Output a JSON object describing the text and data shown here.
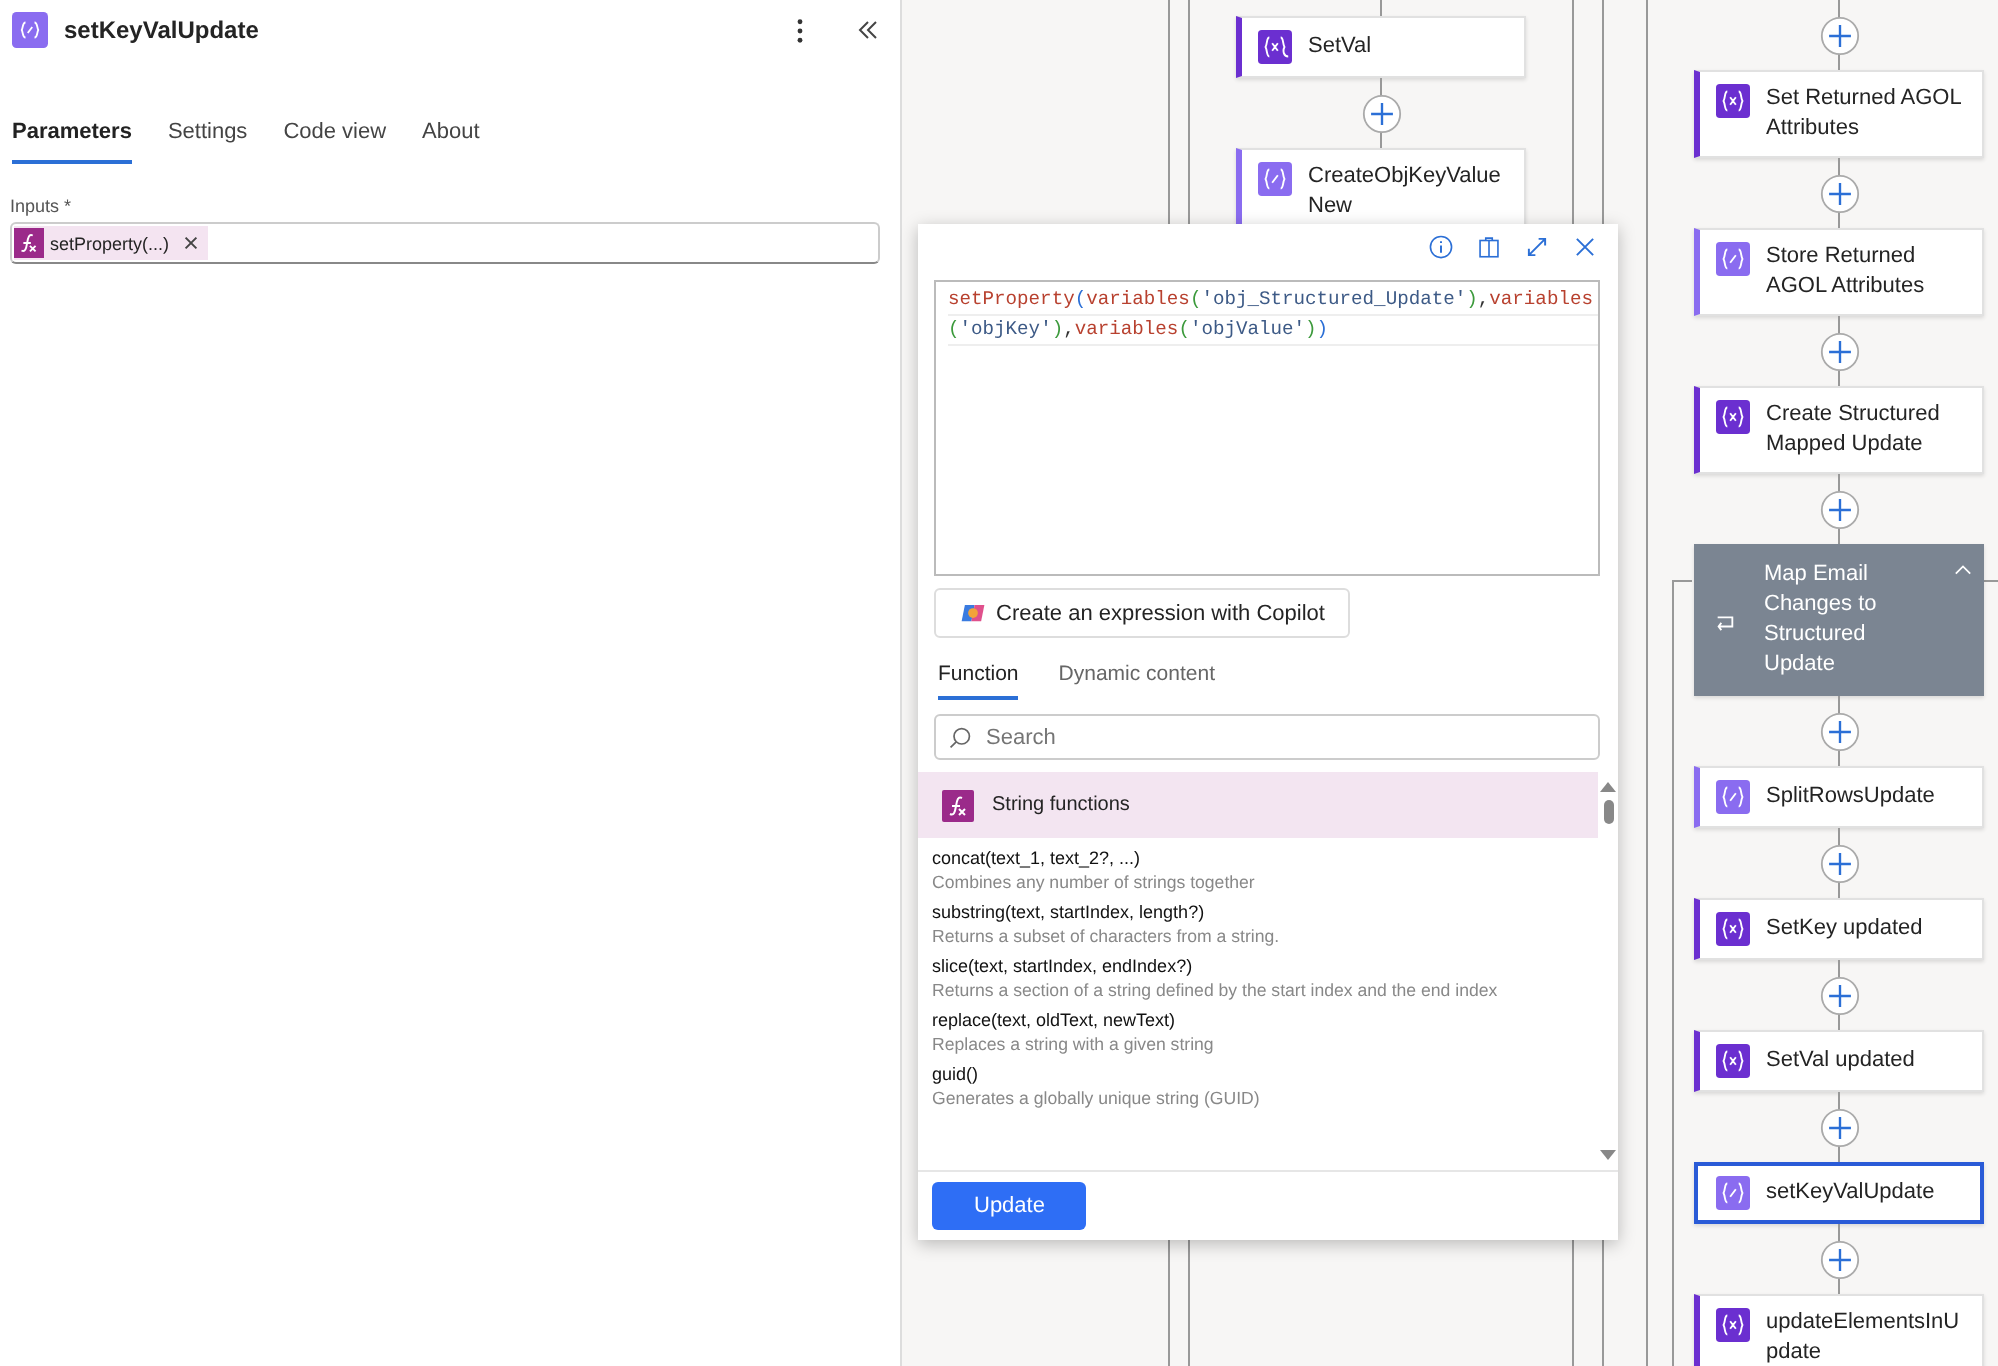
{
  "panel": {
    "title": "setKeyValUpdate",
    "tabs": [
      {
        "label": "Parameters",
        "selected": true
      },
      {
        "label": "Settings",
        "selected": false
      },
      {
        "label": "Code view",
        "selected": false
      },
      {
        "label": "About",
        "selected": false
      }
    ],
    "inputs_label": "Inputs *",
    "input_token": "setProperty(...)"
  },
  "expression_editor": {
    "code_lines": [
      [
        {
          "text": "setProperty",
          "kind": "fn"
        },
        {
          "text": "(",
          "kind": "paren1"
        },
        {
          "text": "variables",
          "kind": "fn"
        },
        {
          "text": "(",
          "kind": "paren2"
        },
        {
          "text": "'obj_Structured_Update'",
          "kind": "str"
        },
        {
          "text": ")",
          "kind": "paren2"
        },
        {
          "text": ",",
          "kind": "comma"
        },
        {
          "text": "variables",
          "kind": "fn"
        }
      ],
      [
        {
          "text": "(",
          "kind": "paren2"
        },
        {
          "text": "'objKey'",
          "kind": "str"
        },
        {
          "text": ")",
          "kind": "paren2"
        },
        {
          "text": ",",
          "kind": "comma"
        },
        {
          "text": "variables",
          "kind": "fn"
        },
        {
          "text": "(",
          "kind": "paren2"
        },
        {
          "text": "'objValue'",
          "kind": "str"
        },
        {
          "text": ")",
          "kind": "paren2"
        },
        {
          "text": ")",
          "kind": "paren1"
        }
      ]
    ],
    "copilot_button": "Create an expression with Copilot",
    "tabs": [
      {
        "label": "Function",
        "selected": true
      },
      {
        "label": "Dynamic content",
        "selected": false
      }
    ],
    "search": {
      "placeholder": "Search"
    },
    "category": "String functions",
    "functions": [
      {
        "name": "concat(text_1, text_2?, ...)",
        "description": "Combines any number of strings together"
      },
      {
        "name": "substring(text, startIndex, length?)",
        "description": "Returns a subset of characters from a string."
      },
      {
        "name": "slice(text, startIndex, endIndex?)",
        "description": "Returns a section of a string defined by the start index and the end index"
      },
      {
        "name": "replace(text, oldText, newText)",
        "description": "Replaces a string with a given string"
      },
      {
        "name": "guid()",
        "description": "Generates a globally unique string (GUID)"
      }
    ],
    "update_button": "Update"
  },
  "flow": {
    "left_column": [
      {
        "label": "SetVal",
        "kind": "set",
        "selected": false
      },
      {
        "label": "CreateObjKeyValueNew",
        "kind": "compose",
        "selected": false
      }
    ],
    "right_column": [
      {
        "label": "Set Returned AGOL Attributes",
        "kind": "set",
        "selected": false
      },
      {
        "label": "Store Returned AGOL Attributes",
        "kind": "compose",
        "selected": false
      },
      {
        "label": "Create Structured Mapped Update",
        "kind": "set",
        "selected": false
      },
      {
        "label": "Map Email Changes to Structured Update",
        "kind": "scope",
        "selected": false
      },
      {
        "label": "SplitRowsUpdate",
        "kind": "compose",
        "selected": false
      },
      {
        "label": "SetKey updated",
        "kind": "set",
        "selected": false
      },
      {
        "label": "SetVal updated",
        "kind": "set",
        "selected": false
      },
      {
        "label": "setKeyValUpdate",
        "kind": "compose",
        "selected": true
      },
      {
        "label": "updateElementsInUpdate",
        "kind": "set",
        "selected": false
      }
    ]
  }
}
